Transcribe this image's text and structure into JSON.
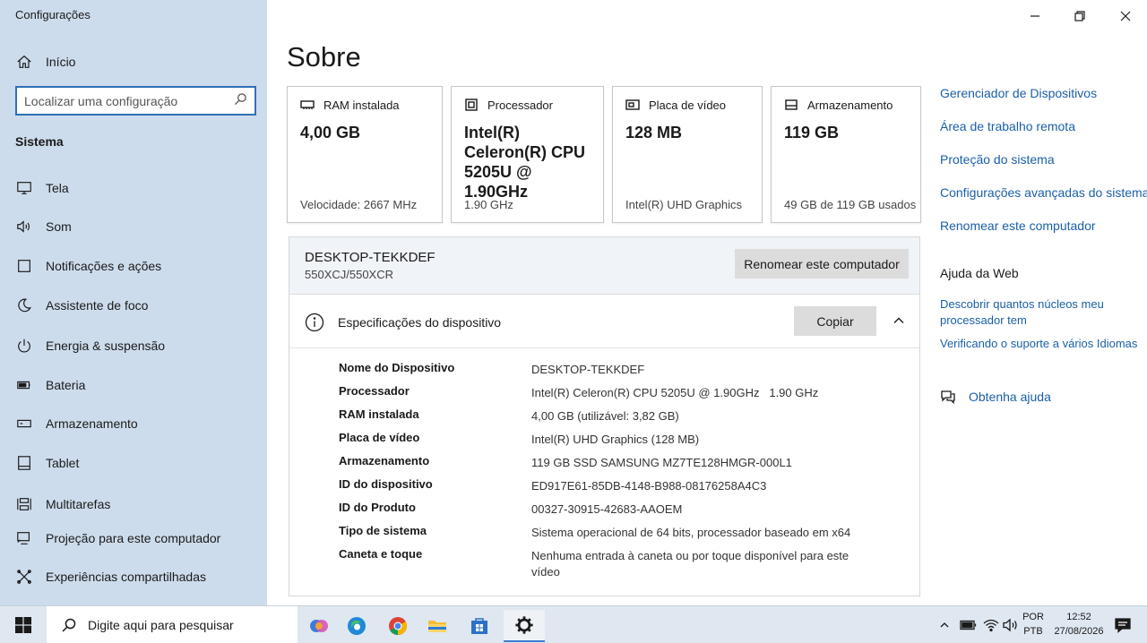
{
  "window": {
    "title": "Configurações"
  },
  "sidebar": {
    "home_label": "Início",
    "search_placeholder": "Localizar uma configuração",
    "section_title": "Sistema",
    "items": [
      {
        "label": "Tela",
        "icon": "monitor-icon"
      },
      {
        "label": "Som",
        "icon": "speaker-icon"
      },
      {
        "label": "Notificações e ações",
        "icon": "notification-icon"
      },
      {
        "label": "Assistente de foco",
        "icon": "moon-icon"
      },
      {
        "label": "Energia & suspensão",
        "icon": "power-icon"
      },
      {
        "label": "Bateria",
        "icon": "battery-icon"
      },
      {
        "label": "Armazenamento",
        "icon": "storage-icon"
      },
      {
        "label": "Tablet",
        "icon": "tablet-icon"
      },
      {
        "label": "Multitarefas",
        "icon": "multitask-icon"
      },
      {
        "label": "Projeção para este computador",
        "icon": "projection-icon"
      },
      {
        "label": "Experiências compartilhadas",
        "icon": "shared-icon"
      }
    ]
  },
  "main": {
    "title": "Sobre",
    "cards": [
      {
        "title": "RAM instalada",
        "value": "4,00 GB",
        "sub": "Velocidade: 2667 MHz",
        "icon": "ram-icon"
      },
      {
        "title": "Processador",
        "value": "Intel(R) Celeron(R) CPU 5205U @ 1.90GHz",
        "sub": "1.90 GHz",
        "icon": "cpu-icon"
      },
      {
        "title": "Placa de vídeo",
        "value": "128 MB",
        "sub": "Intel(R) UHD Graphics",
        "icon": "gpu-icon"
      },
      {
        "title": "Armazenamento",
        "value": "119 GB",
        "sub": "49 GB de 119 GB usados",
        "icon": "drive-icon"
      }
    ],
    "pc": {
      "name": "DESKTOP-TEKKDEF",
      "model": "550XCJ/550XCR",
      "rename_label": "Renomear este computador"
    },
    "specs": {
      "title": "Especificações do dispositivo",
      "copy_label": "Copiar",
      "rows": [
        {
          "k": "Nome do Dispositivo",
          "v": "DESKTOP-TEKKDEF"
        },
        {
          "k": "Processador",
          "v": "Intel(R) Celeron(R) CPU 5205U @ 1.90GHz   1.90 GHz"
        },
        {
          "k": "RAM instalada",
          "v": "4,00 GB (utilizável: 3,82 GB)"
        },
        {
          "k": "Placa de vídeo",
          "v": "Intel(R) UHD Graphics (128 MB)"
        },
        {
          "k": "Armazenamento",
          "v": "119 GB SSD SAMSUNG MZ7TE128HMGR-000L1"
        },
        {
          "k": "ID do dispositivo",
          "v": "ED917E61-85DB-4148-B988-08176258A4C3"
        },
        {
          "k": "ID do Produto",
          "v": "00327-30915-42683-AAOEM"
        },
        {
          "k": "Tipo de sistema",
          "v": "Sistema operacional de 64 bits, processador baseado em x64"
        },
        {
          "k": "Caneta e toque",
          "v": "Nenhuma entrada à caneta ou por toque disponível para este vídeo"
        }
      ]
    }
  },
  "right": {
    "links": [
      "Gerenciador de Dispositivos",
      "Área de trabalho remota",
      "Proteção do sistema",
      "Configurações avançadas do sistema",
      "Renomear este computador"
    ],
    "web_help_title": "Ajuda da Web",
    "web_links": [
      "Descobrir quantos núcleos meu processador tem",
      "Verificando o suporte a vários Idiomas"
    ],
    "get_help": "Obtenha ajuda"
  },
  "taskbar": {
    "search_text": "Digite aqui para pesquisar",
    "lang_top": "POR",
    "lang_bottom": "PTB",
    "time": "12:52",
    "date": "27/08/2026",
    "apps": [
      "copilot-icon",
      "edge-icon",
      "chrome-icon",
      "file-explorer-icon",
      "store-icon",
      "settings-icon"
    ]
  }
}
